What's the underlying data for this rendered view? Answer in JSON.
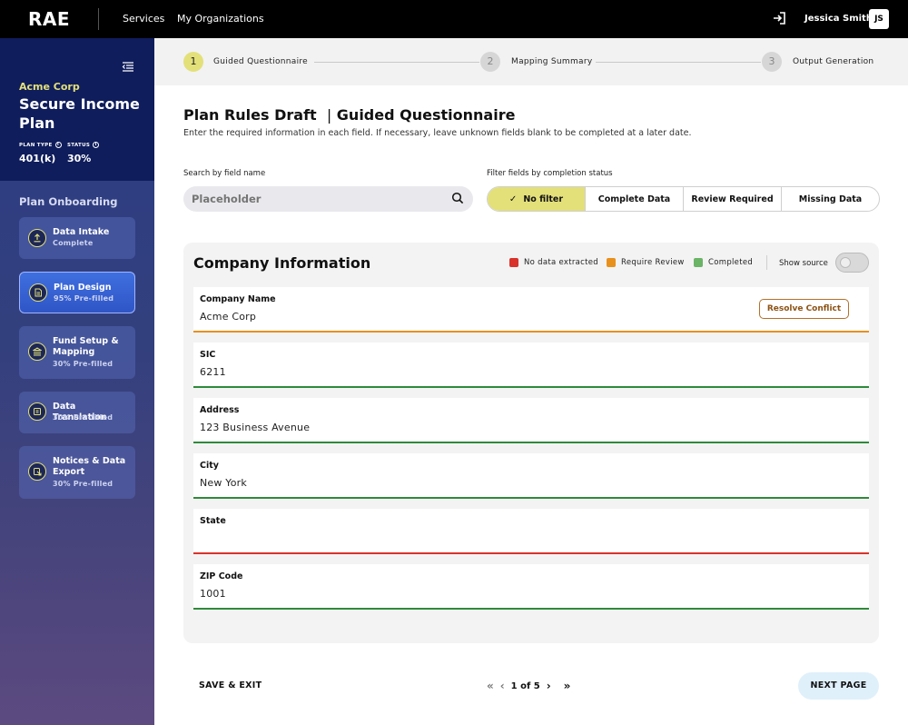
{
  "topbar": {
    "logo": "RAE",
    "nav": [
      "Services",
      "My Organizations"
    ],
    "user_name": "Jessica Smith",
    "user_initials": "JS"
  },
  "sidebar": {
    "org_name": "Acme Corp",
    "plan_name": "Secure Income Plan",
    "plan_type_label": "PLAN TYPE",
    "plan_type_value": "401(k)",
    "status_label": "STATUS",
    "status_value": "30%",
    "section_title": "Plan Onboarding",
    "steps": [
      {
        "title": "Data Intake",
        "subtitle": "Complete",
        "icon": "upload-icon"
      },
      {
        "title": "Plan Design",
        "subtitle": "95% Pre-filled",
        "icon": "document-icon",
        "active": true
      },
      {
        "title": "Fund Setup & Mapping",
        "subtitle": "30% Pre-filled",
        "icon": "bank-icon"
      },
      {
        "title": "Data Translation",
        "subtitle": "30% Pre-filled",
        "icon": "translate-icon"
      },
      {
        "title": "Notices & Data Export",
        "subtitle": "30% Pre-filled",
        "icon": "export-icon"
      }
    ]
  },
  "stepper": {
    "steps": [
      {
        "number": "1",
        "label": "Guided Questionnaire",
        "active": true
      },
      {
        "number": "2",
        "label": "Mapping Summary"
      },
      {
        "number": "3",
        "label": "Output Generation"
      }
    ]
  },
  "main": {
    "title": "Plan Rules Draft",
    "title_sep": "|",
    "subtitle": "Guided Questionnaire",
    "description": "Enter the required information in each field. If necessary, leave unknown fields blank to be completed at a later date.",
    "search_label": "Search by field name",
    "search_placeholder": "Placeholder",
    "filter_label": "Filter fields by completion status",
    "filters": [
      "No filter",
      "Complete Data",
      "Review Required",
      "Missing Data"
    ],
    "active_filter": "No filter"
  },
  "panel": {
    "title": "Company Information",
    "legend": [
      {
        "label": "No data extracted",
        "color": "#d9322b"
      },
      {
        "label": "Require Review",
        "color": "#e8901c"
      },
      {
        "label": "Completed",
        "color": "#6ab466"
      }
    ],
    "show_source_label": "Show source",
    "show_source_on": false,
    "resolve_label": "Resolve Conflict",
    "fields": [
      {
        "label": "Company Name",
        "value": "Acme Corp",
        "status_color": "#e8901c"
      },
      {
        "label": "SIC",
        "value": "6211",
        "status_color": "#2e8a3a"
      },
      {
        "label": "Address",
        "value": "123 Business Avenue",
        "status_color": "#2e8a3a"
      },
      {
        "label": "City",
        "value": "New York",
        "status_color": "#2e8a3a"
      },
      {
        "label": "State",
        "value": "",
        "status_color": "#d9322b"
      },
      {
        "label": "ZIP Code",
        "value": "1001",
        "status_color": "#2e8a3a"
      }
    ]
  },
  "footer": {
    "save_exit": "SAVE & EXIT",
    "page_indicator": "1 of 5",
    "next_page": "NEXT PAGE"
  }
}
